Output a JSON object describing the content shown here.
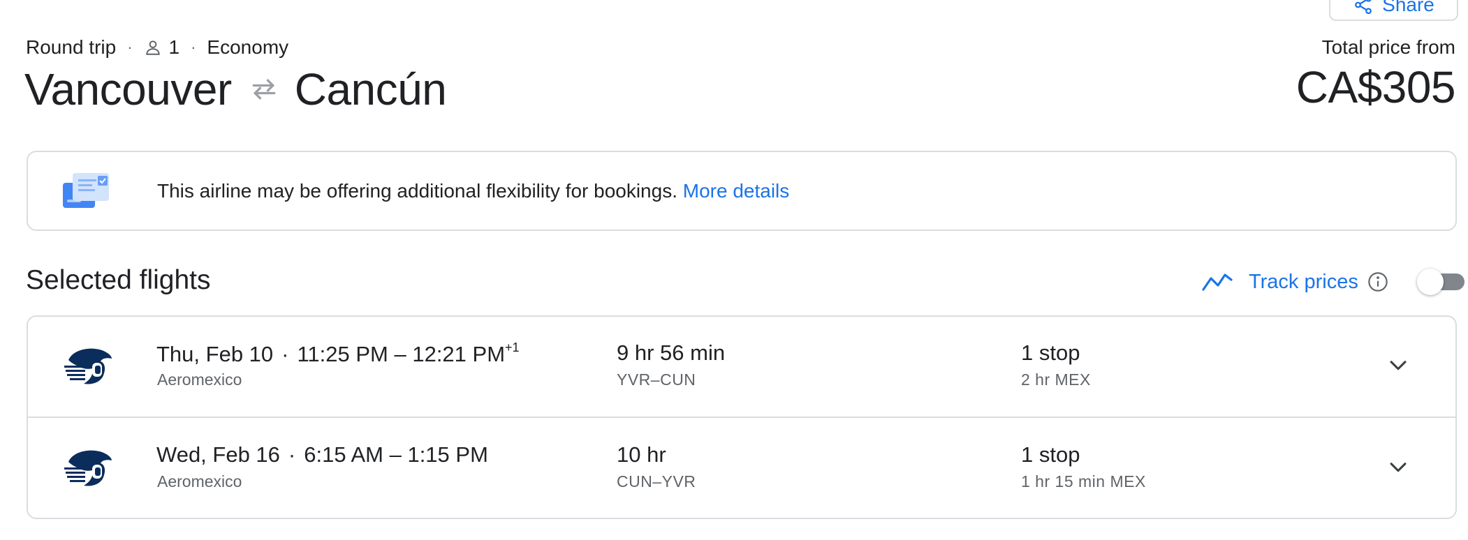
{
  "header": {
    "share_label": "Share",
    "trip_type": "Round trip",
    "passengers": "1",
    "cabin_class": "Economy",
    "origin": "Vancouver",
    "destination": "Cancún",
    "price_label": "Total price from",
    "price": "CA$305"
  },
  "banner": {
    "text": "This airline may be offering additional flexibility for bookings.",
    "link": "More details"
  },
  "selected": {
    "title": "Selected flights",
    "track_label": "Track prices",
    "track_enabled": false
  },
  "flights": [
    {
      "date": "Thu, Feb 10",
      "times": "11:25 PM – 12:21 PM",
      "day_offset": "+1",
      "airline": "Aeromexico",
      "duration": "9 hr 56 min",
      "airports": "YVR–CUN",
      "stops": "1 stop",
      "layover": "2 hr MEX"
    },
    {
      "date": "Wed, Feb 16",
      "times": "6:15 AM – 1:15 PM",
      "day_offset": "",
      "airline": "Aeromexico",
      "duration": "10 hr",
      "airports": "CUN–YVR",
      "stops": "1 stop",
      "layover": "1 hr 15 min MEX"
    }
  ],
  "colors": {
    "accent": "#1a73e8",
    "text": "#202124",
    "muted": "#5f6368",
    "border": "#dadce0",
    "airline_navy": "#0b2d5b"
  },
  "icons": {
    "share": "share-icon",
    "person": "person-icon",
    "swap": "swap-arrows-icon",
    "banner": "flexible-booking-icon",
    "trend": "price-trend-icon",
    "info": "info-icon",
    "airline": "aeromexico-logo-icon",
    "expand": "chevron-down-icon"
  }
}
